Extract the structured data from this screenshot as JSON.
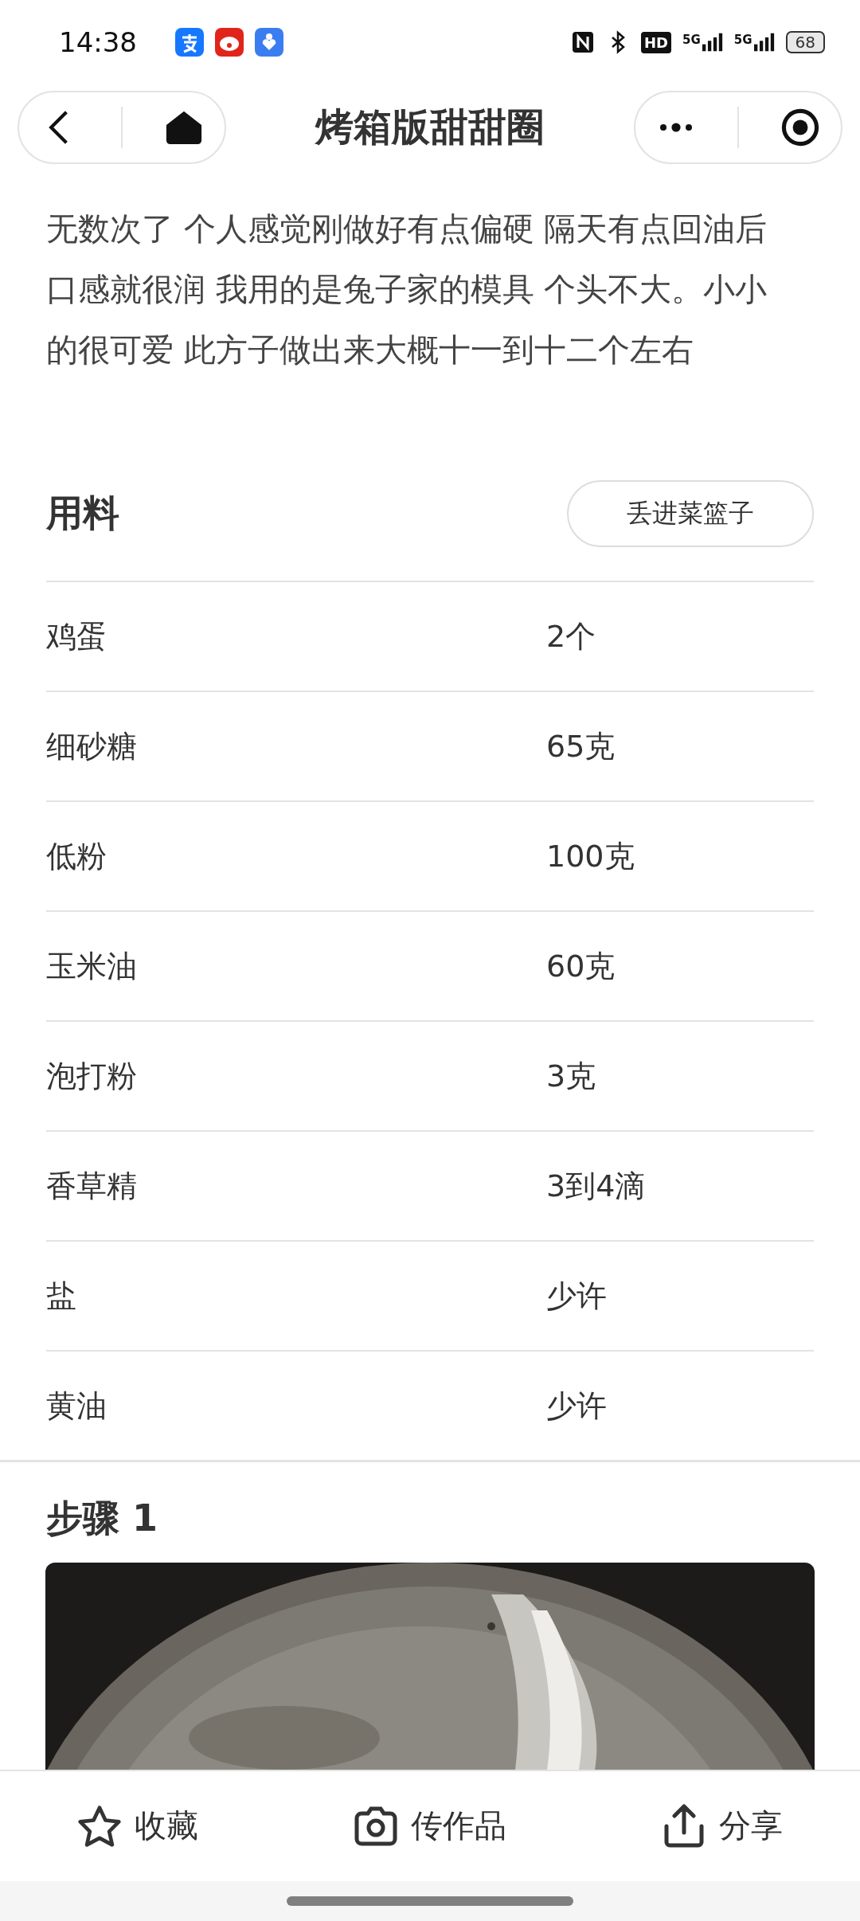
{
  "status_bar": {
    "time": "14:38",
    "hd": "HD",
    "networks": [
      "5G",
      "5G"
    ],
    "battery": "68"
  },
  "header": {
    "title": "烤箱版甜甜圈"
  },
  "description": [
    "无数次了 个人感觉刚做好有点偏硬 隔天有点回油后",
    "口感就很润 我用的是兔子家的模具 个头不大。小小",
    "的很可爱 此方子做出来大概十一到十二个左右"
  ],
  "ingredients": {
    "heading": "用料",
    "button": "丢进菜篮子",
    "rows": [
      {
        "name": "鸡蛋",
        "amount": "2个"
      },
      {
        "name": "细砂糖",
        "amount": "65克"
      },
      {
        "name": "低粉",
        "amount": "100克"
      },
      {
        "name": "玉米油",
        "amount": "60克"
      },
      {
        "name": "泡打粉",
        "amount": "3克"
      },
      {
        "name": "香草精",
        "amount": "3到4滴"
      },
      {
        "name": "盐",
        "amount": "少许"
      },
      {
        "name": "黄油",
        "amount": "少许"
      }
    ]
  },
  "steps": [
    {
      "heading": "步骤 1"
    }
  ],
  "bottom_bar": [
    {
      "label": "收藏",
      "kind": "favorite"
    },
    {
      "label": "传作品",
      "kind": "upload"
    },
    {
      "label": "分享",
      "kind": "share"
    }
  ]
}
